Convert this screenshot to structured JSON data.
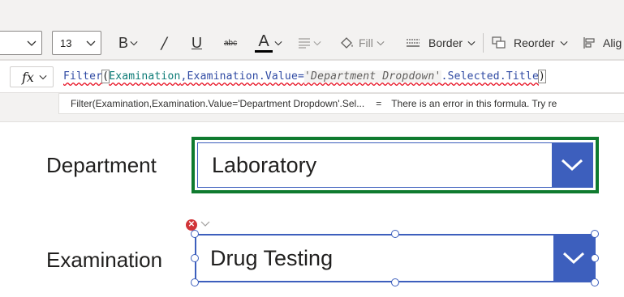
{
  "toolbar": {
    "font_size": "13",
    "bold_icon": "bold-icon",
    "italic_icon": "italic-icon",
    "underline_icon": "underline-icon",
    "strikethrough_label": "abc",
    "font_color_label": "A",
    "align_icon": "align-icon",
    "fill_label": "Fill",
    "border_label": "Border",
    "reorder_label": "Reorder",
    "align_label": "Alig",
    "font_color_bar": "#000000"
  },
  "formula_bar": {
    "fx_label": "fx",
    "tokens": {
      "fn": "Filter",
      "open": "(",
      "ds": "Examination",
      "mid": ",Examination.Value=",
      "str": "'Department Dropdown'",
      "tail": ".Selected.Title",
      "close": ")"
    }
  },
  "hint": {
    "formula": "Filter(Examination,Examination.Value='Department Dropdown'.Sel...",
    "equals": "=",
    "message": "There is an error in this formula. Try re"
  },
  "canvas": {
    "department_label": "Department",
    "department_value": "Laboratory",
    "examination_label": "Examination",
    "examination_value": "Drug Testing",
    "colors": {
      "accent": "#3d5fbd",
      "selected_border": "#0f7b2f",
      "error": "#d13438"
    }
  }
}
